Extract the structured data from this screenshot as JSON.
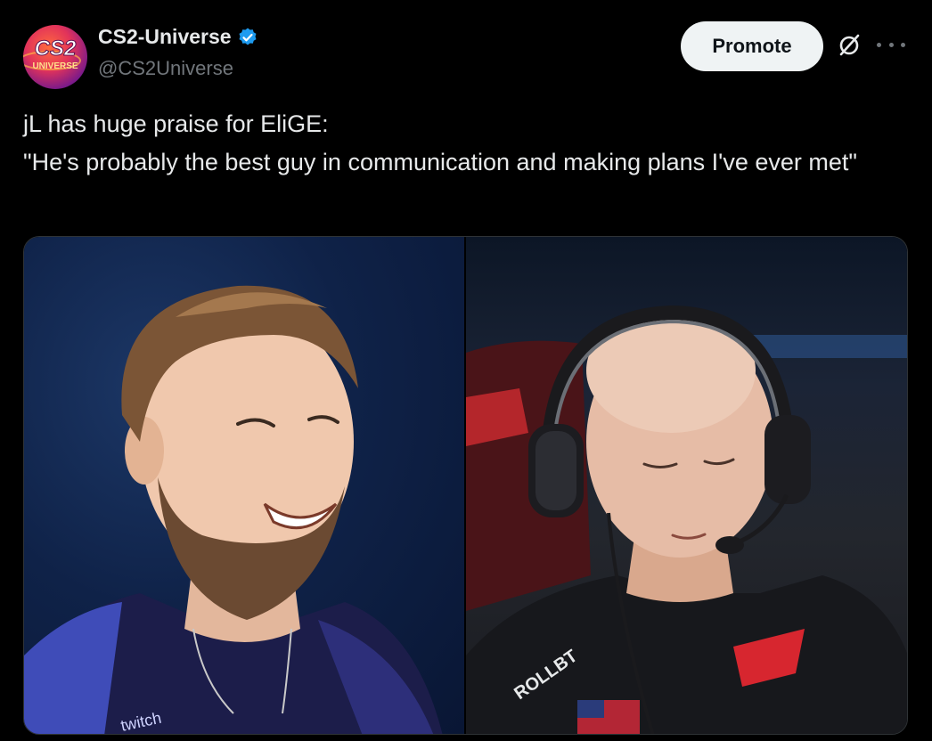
{
  "author": {
    "display_name": "CS2-Universe",
    "handle": "@CS2Universe",
    "verified": true,
    "avatar_logo_text": "CS2",
    "avatar_sub_text": "UNIVERSE"
  },
  "header_actions": {
    "promote_label": "Promote",
    "grok_icon": "grok-icon",
    "more_icon": "more-icon"
  },
  "tweet": {
    "line1": "jL has huge praise for EliGE:",
    "line2": "\"He's probably the best guy in communication and making plans I've ever met\""
  },
  "media": {
    "left_image": "photo-smiling-player",
    "right_image": "photo-player-with-headset"
  },
  "colors": {
    "background": "#000000",
    "text_primary": "#e7e9ea",
    "text_secondary": "#71767b",
    "verified_blue": "#1d9bf0",
    "promote_bg": "#eff3f4"
  }
}
